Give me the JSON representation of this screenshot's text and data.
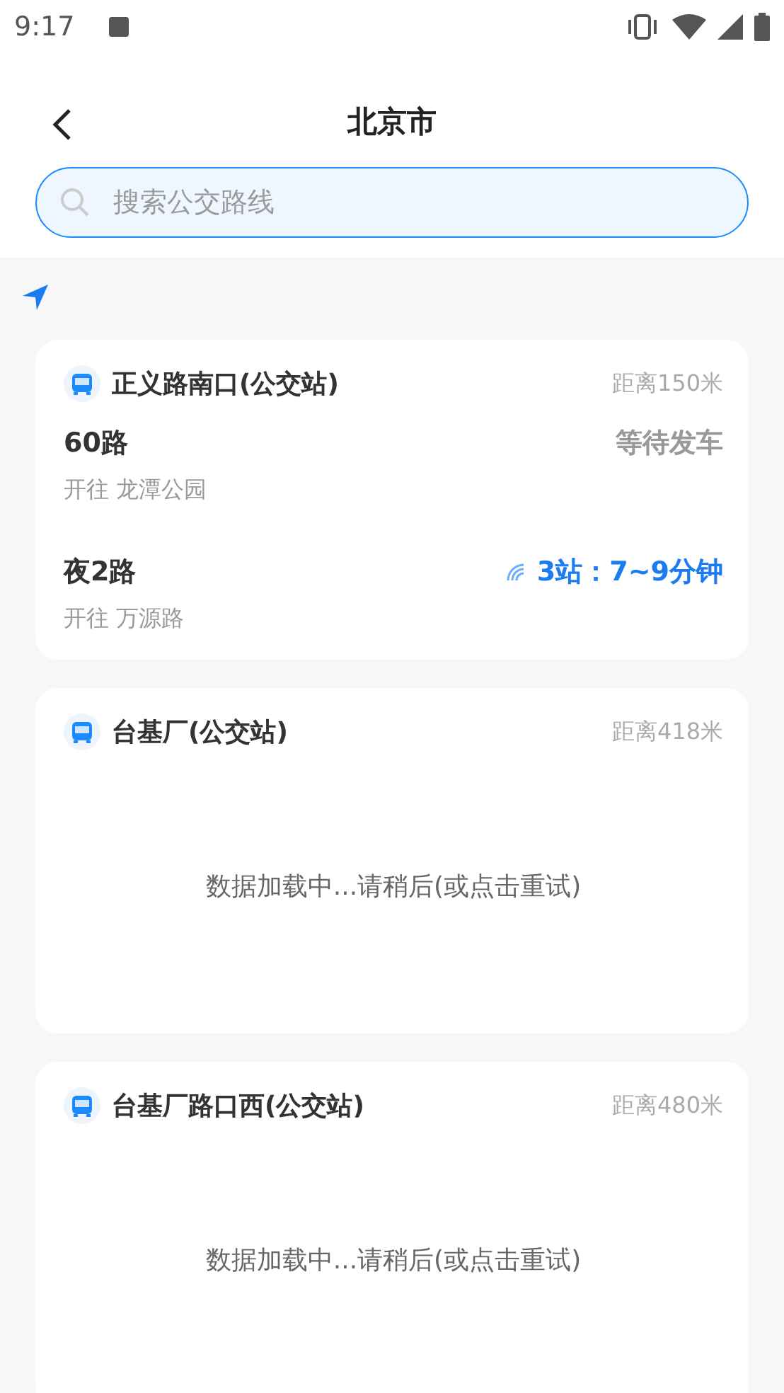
{
  "status_bar": {
    "time": "9:17"
  },
  "header": {
    "title": "北京市"
  },
  "search": {
    "placeholder": "搜索公交路线"
  },
  "stations": [
    {
      "kind": "routes",
      "name": "正义路南口(公交站)",
      "distance": "距离150米",
      "routes": [
        {
          "name": "60路",
          "direction": "开往 龙潭公园",
          "status": "等待发车",
          "kind": "waiting"
        },
        {
          "name": "夜2路",
          "direction": "开往 万源路",
          "status": "3站：7~9分钟",
          "kind": "realtime"
        }
      ]
    },
    {
      "kind": "loading",
      "name": "台基厂(公交站)",
      "distance": "距离418米",
      "message": "数据加载中...请稍后(或点击重试)"
    },
    {
      "kind": "loading",
      "name": "台基厂路口西(公交站)",
      "distance": "距离480米",
      "message": "数据加载中...请稍后(或点击重试)"
    }
  ]
}
